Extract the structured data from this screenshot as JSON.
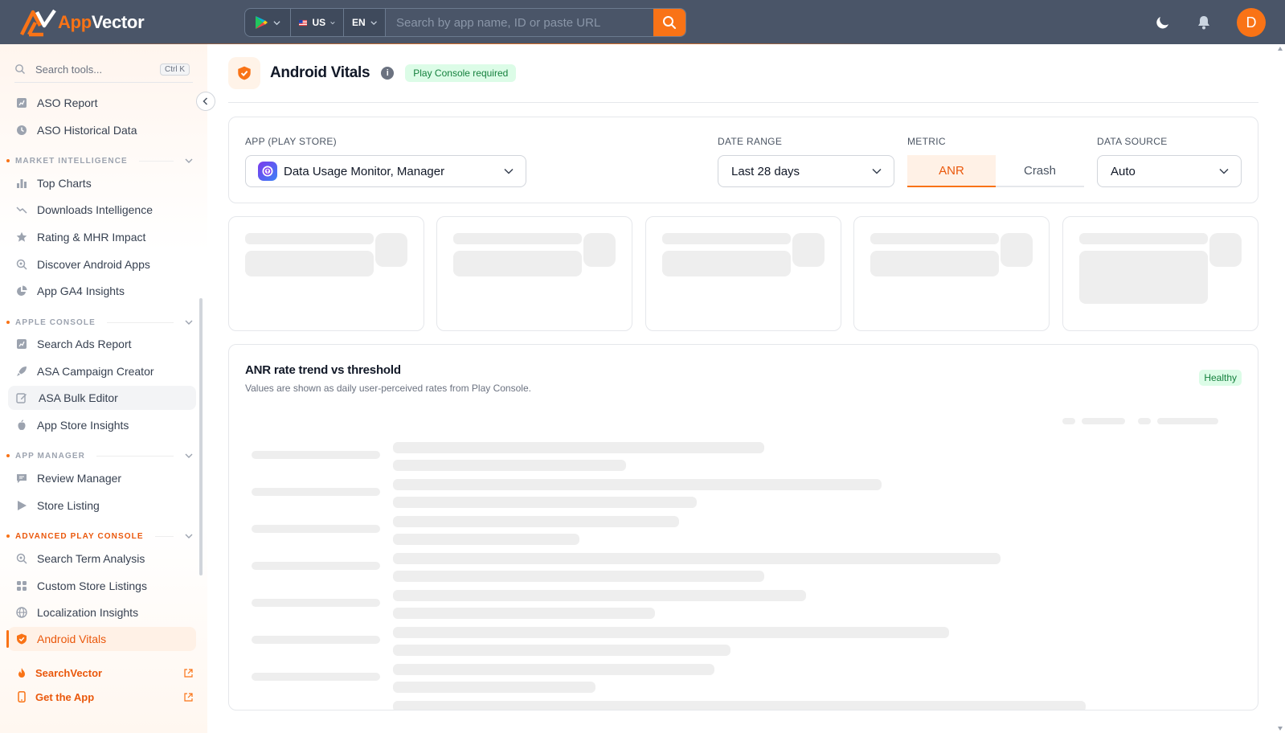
{
  "brand": {
    "name_part1": "App",
    "name_part2": "Vector"
  },
  "topbar": {
    "store_icon": "google-play-icon",
    "country": "US",
    "language": "EN",
    "search_placeholder": "Search by app name, ID or paste URL",
    "avatar_initial": "D"
  },
  "sidebar": {
    "search_placeholder": "Search tools...",
    "search_shortcut": "Ctrl K",
    "top_items": [
      {
        "label": "ASO Report",
        "icon": "chart-icon"
      },
      {
        "label": "ASO Historical Data",
        "icon": "clock-icon"
      }
    ],
    "sections": [
      {
        "title": "MARKET INTELLIGENCE",
        "items": [
          {
            "label": "Top Charts",
            "icon": "bar-chart-icon"
          },
          {
            "label": "Downloads Intelligence",
            "icon": "trend-down-icon"
          },
          {
            "label": "Rating & MHR Impact",
            "icon": "star-icon"
          },
          {
            "label": "Discover Android Apps",
            "icon": "search-icon"
          },
          {
            "label": "App GA4 Insights",
            "icon": "pie-chart-icon"
          }
        ]
      },
      {
        "title": "APPLE CONSOLE",
        "items": [
          {
            "label": "Search Ads Report",
            "icon": "chart-icon"
          },
          {
            "label": "ASA Campaign Creator",
            "icon": "rocket-icon"
          },
          {
            "label": "ASA Bulk Editor",
            "icon": "edit-icon"
          },
          {
            "label": "App Store Insights",
            "icon": "apple-icon"
          }
        ]
      },
      {
        "title": "APP MANAGER",
        "items": [
          {
            "label": "Review Manager",
            "icon": "message-icon"
          },
          {
            "label": "Store Listing",
            "icon": "play-icon"
          }
        ]
      },
      {
        "title": "ADVANCED PLAY CONSOLE",
        "items": [
          {
            "label": "Search Term Analysis",
            "icon": "search-icon"
          },
          {
            "label": "Custom Store Listings",
            "icon": "grid-icon"
          },
          {
            "label": "Localization Insights",
            "icon": "globe-icon"
          },
          {
            "label": "Android Vitals",
            "icon": "shield-icon"
          }
        ]
      }
    ],
    "links": [
      {
        "label": "SearchVector",
        "icon": "flame-icon"
      },
      {
        "label": "Get the App",
        "icon": "phone-icon"
      }
    ]
  },
  "page": {
    "title": "Android Vitals",
    "badge": "Play Console required"
  },
  "filters": {
    "app_label": "APP (PLAY STORE)",
    "app_value": "Data Usage Monitor, Manager",
    "date_label": "DATE RANGE",
    "date_value": "Last 28 days",
    "metric_label": "METRIC",
    "metric_options": [
      "ANR",
      "Crash"
    ],
    "metric_selected": "ANR",
    "source_label": "DATA SOURCE",
    "source_value": "Auto"
  },
  "trend": {
    "title": "ANR rate trend vs threshold",
    "subtitle": "Values are shown as daily user-perceived rates from Play Console.",
    "status": "Healthy"
  },
  "colors": {
    "accent": "#f97316",
    "topbar": "#4a5568",
    "success_bg": "#dcfce7",
    "success_text": "#15803d",
    "skeleton": "#eeeeee"
  }
}
